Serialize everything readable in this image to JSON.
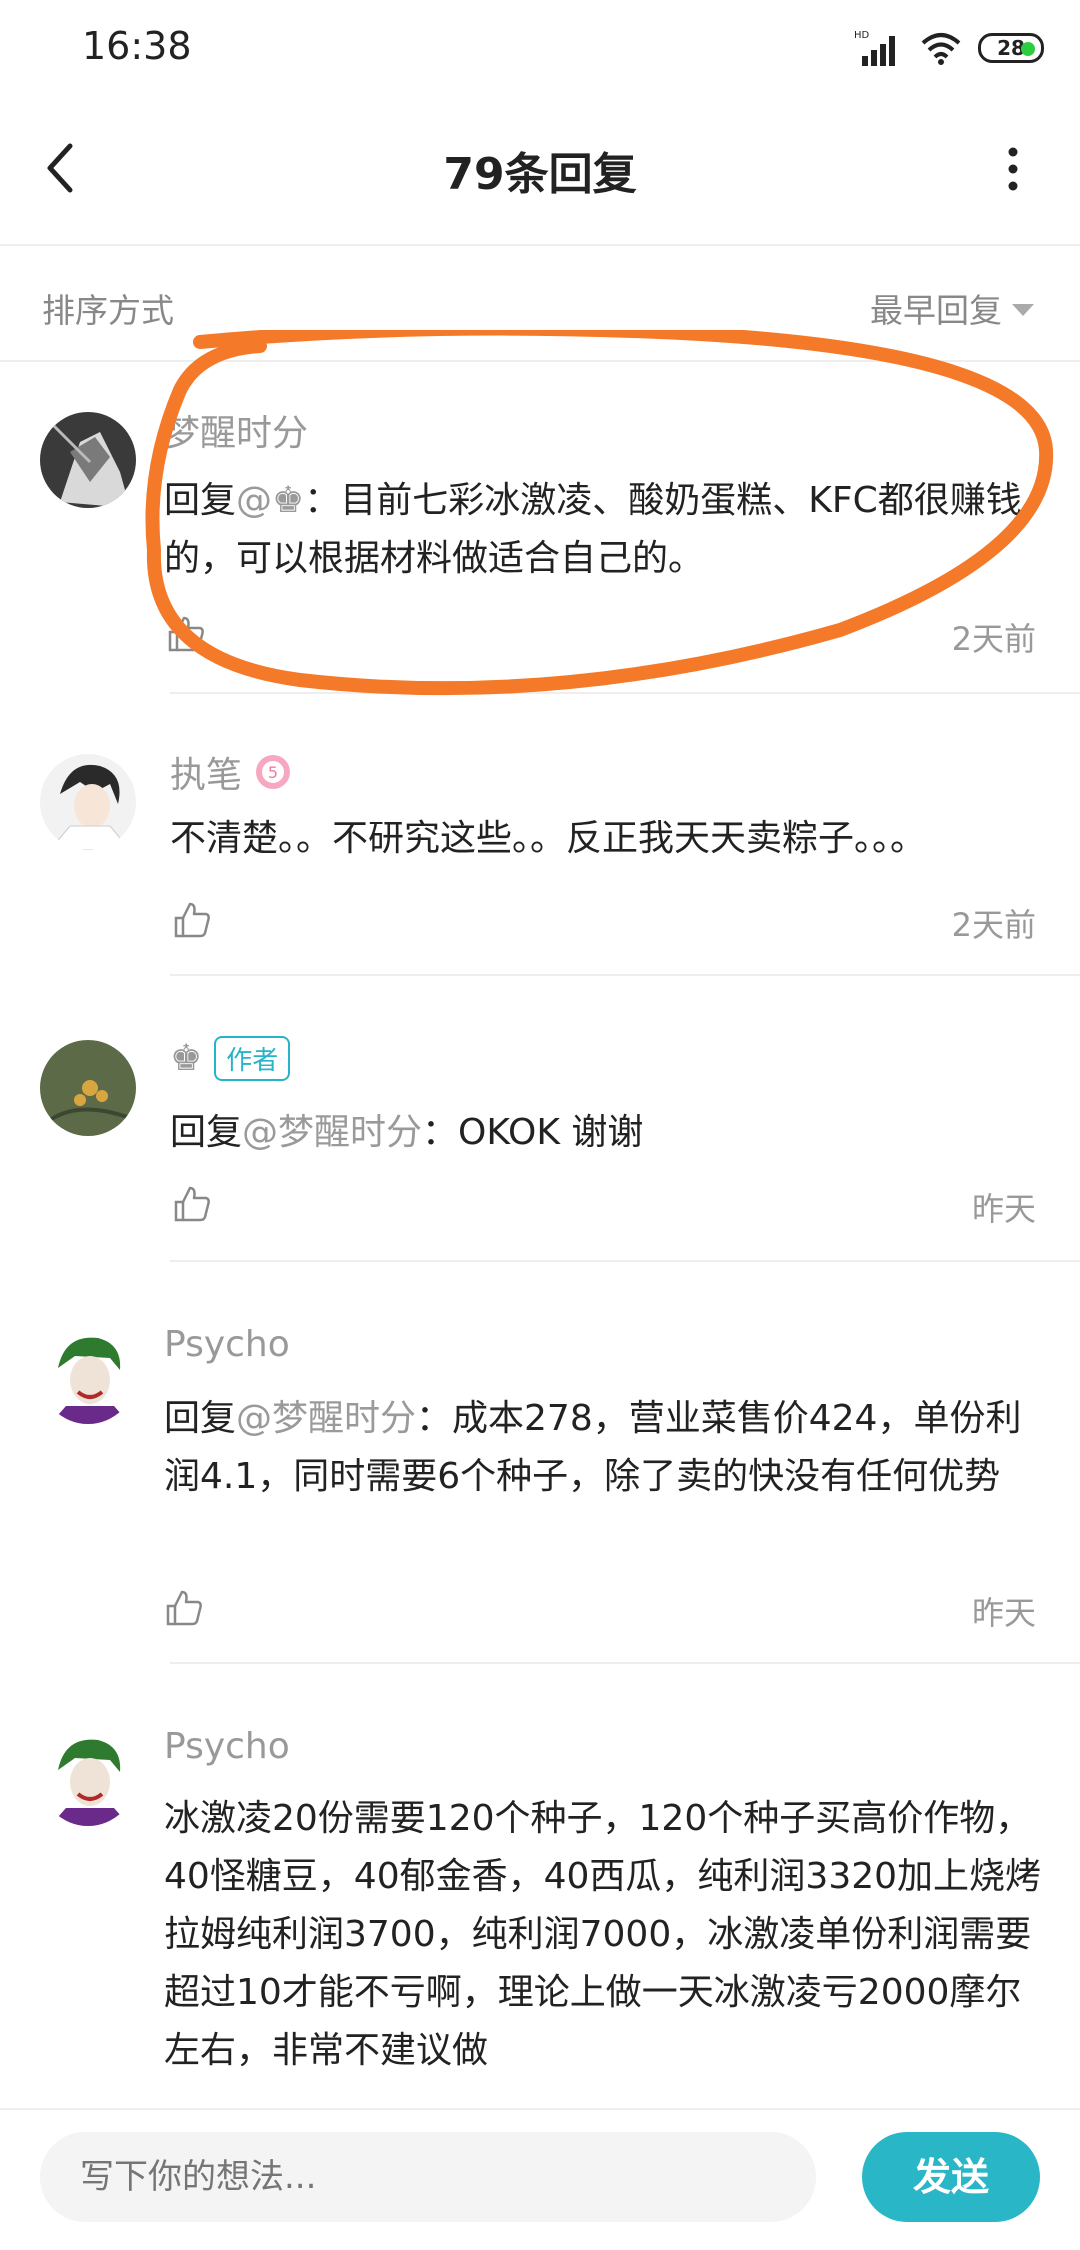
{
  "status_bar": {
    "time": "16:38",
    "battery": "28"
  },
  "header": {
    "title": "79条回复"
  },
  "sort": {
    "label": "排序方式",
    "value": "最早回复"
  },
  "comments": [
    {
      "user": "梦醒时分",
      "text_prefix": "回复",
      "mention": "@♚",
      "text": "：目前七彩冰激凌、酸奶蛋糕、KFC都很赚钱的，可以根据材料做适合自己的。",
      "time": "2天前"
    },
    {
      "user": "执笔",
      "text": "不清楚。。不研究这些。。反正我天天卖粽子。。。",
      "time": "2天前"
    },
    {
      "user": "♚",
      "badge": "作者",
      "text_prefix": "回复",
      "mention": "@梦醒时分",
      "text": "：OKOK  谢谢",
      "time": "昨天"
    },
    {
      "user": "Psycho",
      "text_prefix": "回复",
      "mention": "@梦醒时分",
      "text": "：成本278，营业菜售价424，单份利润4.1，同时需要6个种子，除了卖的快没有任何优势",
      "time": "昨天"
    },
    {
      "user": "Psycho",
      "text": "冰激凌20份需要120个种子，120个种子买高价作物，40怪糖豆，40郁金香，40西瓜，纯利润3320加上烧烤拉姆纯利润3700，纯利润7000，冰激凌单份利润需要超过10才能不亏啊，理论上做一天冰激凌亏2000摩尔左右，非常不建议做"
    }
  ],
  "composer": {
    "placeholder": "写下你的想法...",
    "send_label": "发送"
  },
  "colors": {
    "accent": "#29b6c6",
    "annotation": "#f47a2a"
  }
}
